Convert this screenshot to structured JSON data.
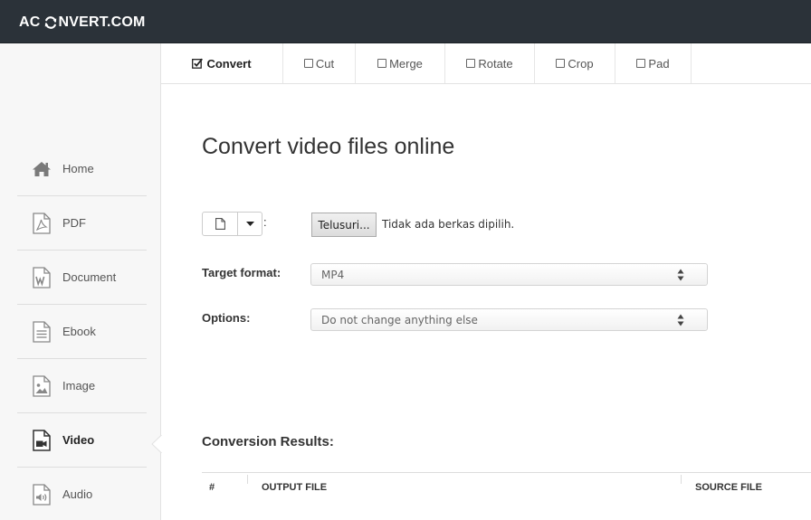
{
  "app": {
    "logo_left": "AC",
    "logo_right": "NVERT.COM"
  },
  "sidebar": {
    "items": [
      {
        "label": "Home",
        "icon": "home-icon"
      },
      {
        "label": "PDF",
        "icon": "pdf-file-icon"
      },
      {
        "label": "Document",
        "icon": "word-document-icon"
      },
      {
        "label": "Ebook",
        "icon": "ebook-file-icon"
      },
      {
        "label": "Image",
        "icon": "image-file-icon"
      },
      {
        "label": "Video",
        "icon": "video-file-icon",
        "active": true
      },
      {
        "label": "Audio",
        "icon": "audio-file-icon"
      }
    ]
  },
  "tabs": [
    {
      "label": "Convert",
      "checked": true
    },
    {
      "label": "Cut",
      "checked": false
    },
    {
      "label": "Merge",
      "checked": false
    },
    {
      "label": "Rotate",
      "checked": false
    },
    {
      "label": "Crop",
      "checked": false
    },
    {
      "label": "Pad",
      "checked": false
    }
  ],
  "main": {
    "title": "Convert video files online",
    "file_colon": ":",
    "browse_label": "Telusuri...",
    "no_file_text": "Tidak ada berkas dipilih.",
    "target_format_label": "Target format:",
    "target_format_value": "MP4",
    "options_label": "Options:",
    "options_value": "Do not change anything else"
  },
  "results": {
    "title": "Conversion Results:",
    "columns": [
      "#",
      "OUTPUT FILE",
      "SOURCE FILE"
    ]
  },
  "colors": {
    "header_bg": "#2b3239",
    "sidebar_bg": "#f7f7f7",
    "icon_gray": "#777777",
    "icon_dark": "#333333"
  }
}
